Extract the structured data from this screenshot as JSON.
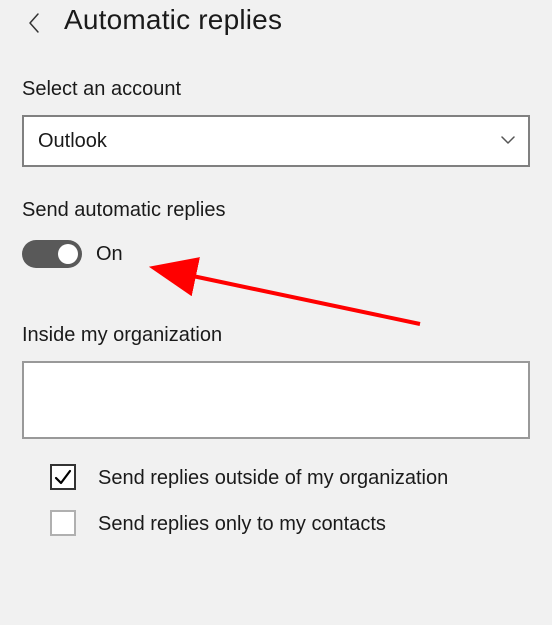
{
  "header": {
    "title": "Automatic replies"
  },
  "account": {
    "label": "Select an account",
    "selected": "Outlook"
  },
  "autoReply": {
    "label": "Send automatic replies",
    "stateText": "On"
  },
  "inside": {
    "label": "Inside my organization",
    "text": ""
  },
  "outside": {
    "checkbox1Label": "Send replies outside of my organization",
    "checkbox2Label": "Send replies only to my contacts"
  },
  "icons": {
    "back": "back-chevron",
    "caret": "dropdown-caret",
    "check": "checkmark"
  },
  "annotation": {
    "color": "#ff0000"
  }
}
